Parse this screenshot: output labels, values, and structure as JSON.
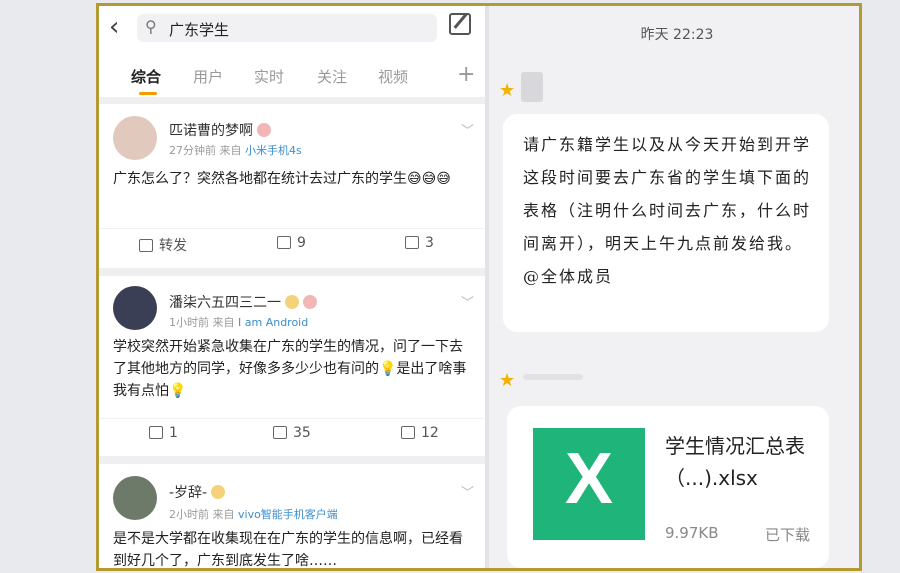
{
  "search": {
    "query": "广东学生"
  },
  "tabs": [
    "综合",
    "用户",
    "实时",
    "关注",
    "视频"
  ],
  "posts": [
    {
      "user": "匹诺曹的梦啊",
      "time": "27分钟前",
      "from": "来自",
      "source": "小米手机4s",
      "text": "广东怎么了？突然各地都在统计去过广东的学生😅😅😅",
      "repost": "转发",
      "comments": "9",
      "likes": "3"
    },
    {
      "user": "潘柒六五四三二一",
      "time": "1小时前",
      "from": "来自",
      "source": "I am Android",
      "text": "学校突然开始紧急收集在广东的学生的情况，问了一下去了其他地方的同学，好像多多少少也有问的💡是出了啥事我有点怕💡",
      "repost": "1",
      "comments": "35",
      "likes": "12"
    },
    {
      "user": "-岁辞-",
      "time": "2小时前",
      "from": "来自",
      "source": "vivo智能手机客户端",
      "text": "是不是大学都在收集现在在广东的学生的信息啊，已经看到好几个了，广东到底发生了啥……"
    }
  ],
  "chat": {
    "timestamp": "昨天 22:23",
    "message": "请广东籍学生以及从今天开始到开学这段时间要去广东省的学生填下面的表格（注明什么时间去广东，什么时间离开），明天上午九点前发给我。@全体成员",
    "file": {
      "name": "学生情况汇总表（...).xlsx",
      "size": "9.97KB",
      "status": "已下载",
      "icon_letter": "X"
    }
  },
  "colors": {
    "accent": "#f59b00",
    "excel": "#1fb57a",
    "frame": "#b39a32"
  }
}
